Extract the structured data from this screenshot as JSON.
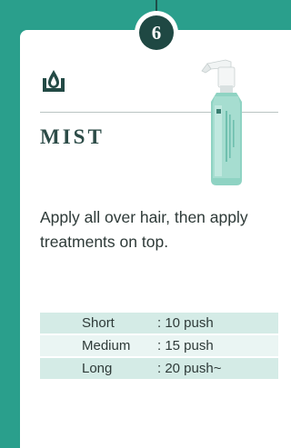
{
  "step_number": "6",
  "title": "MIST",
  "description": "Apply all over hair, then apply treatments on top.",
  "usage_table": [
    {
      "length": "Short",
      "amount": ": 10 push"
    },
    {
      "length": "Medium",
      "amount": ": 15 push"
    },
    {
      "length": "Long",
      "amount": ": 20 push~"
    }
  ],
  "colors": {
    "background": "#2a9f8c",
    "badge": "#1f4843",
    "row_dark": "#d4ebe6",
    "row_light": "#eaf5f3"
  },
  "icons": [
    "drop-icon",
    "spray-bottle-image"
  ]
}
